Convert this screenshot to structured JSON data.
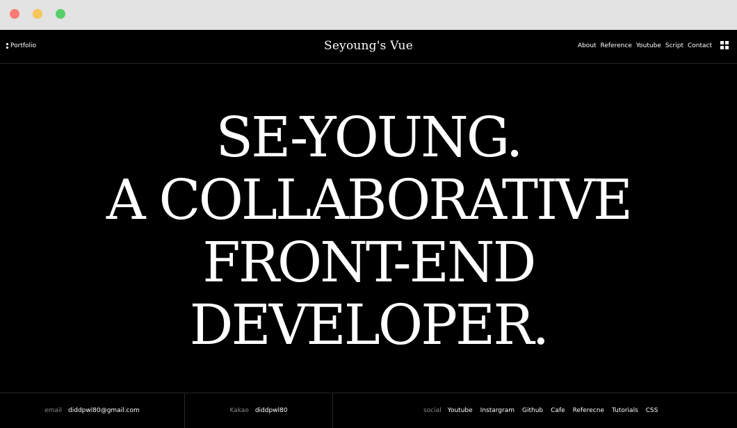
{
  "header": {
    "brand": "Portfolio",
    "title": "Seyoung's Vue",
    "nav": [
      "About",
      "Reference",
      "Youtube",
      "Script",
      "Contact"
    ]
  },
  "hero": {
    "lines": [
      "SE-YOUNG.",
      "A COLLABORATIVE",
      "FRONT-END",
      "DEVELOPER."
    ]
  },
  "footer": {
    "email_label": "email",
    "email_value": "diddpwl80@gmail.com",
    "kakao_label": "Kakao",
    "kakao_value": "diddpwl80",
    "social_label": "social",
    "social_links": [
      "Youtube",
      "Instargram",
      "Github",
      "Cafe",
      "Referecne",
      "Tutorials",
      "CSS"
    ]
  },
  "colors": {
    "background": "#000000",
    "text": "#ffffff",
    "muted": "#8a8a8a",
    "chrome": "#e3e3e3",
    "dot_red": "#ff5f57",
    "dot_yellow": "#febc2e",
    "dot_green": "#28c840"
  },
  "icons": {
    "brand": "two-dots-icon",
    "menu": "grid-menu-icon"
  }
}
